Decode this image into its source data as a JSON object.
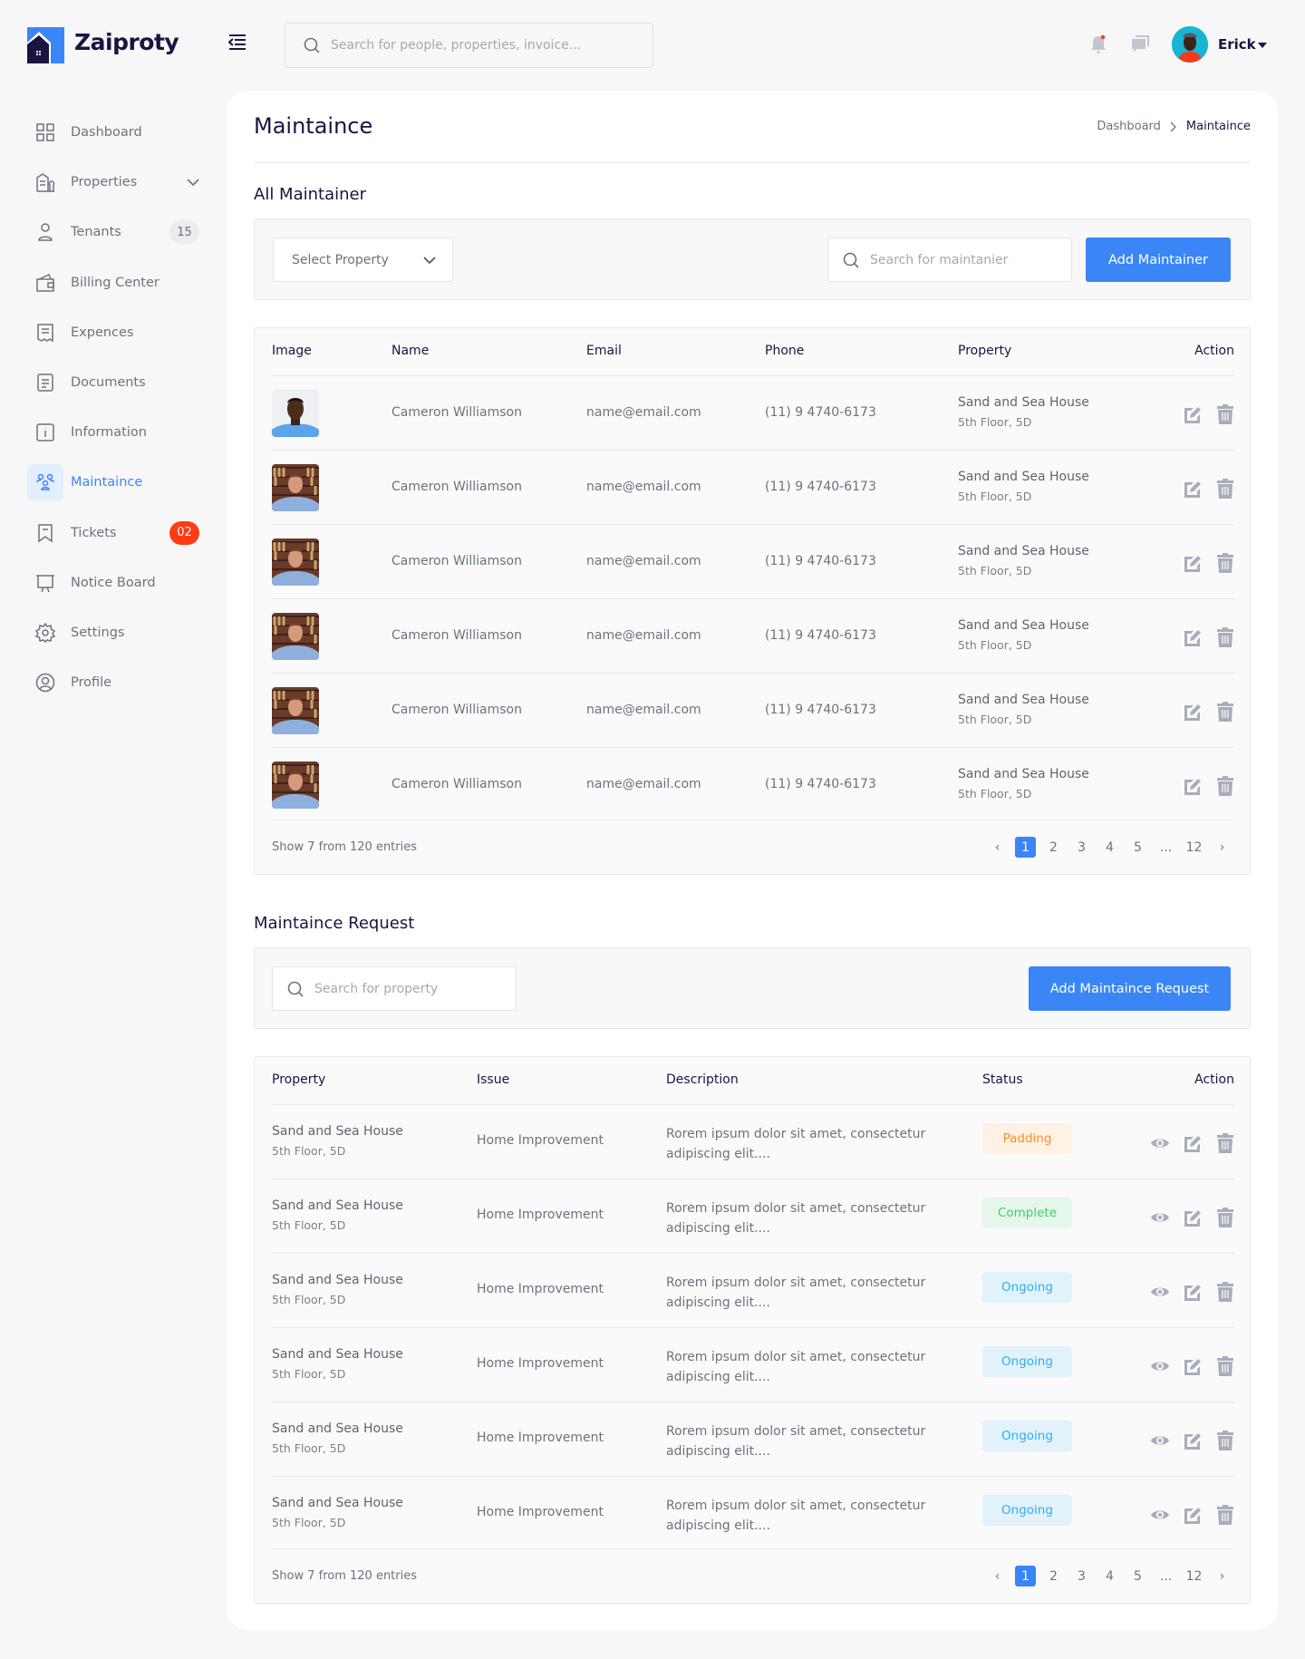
{
  "app": {
    "brand": "Zaiproty",
    "search_placeholder": "Search for people, properties, invoice...",
    "user": "Erick"
  },
  "sidebar": {
    "items": [
      {
        "label": "Dashboard",
        "icon": "dashboard-icon"
      },
      {
        "label": "Properties",
        "icon": "building-icon",
        "chevron": true
      },
      {
        "label": "Tenants",
        "icon": "user-icon",
        "badge": "15"
      },
      {
        "label": "Billing Center",
        "icon": "wallet-icon"
      },
      {
        "label": "Expences",
        "icon": "receipt-icon"
      },
      {
        "label": "Documents",
        "icon": "document-icon"
      },
      {
        "label": "Information",
        "icon": "info-icon"
      },
      {
        "label": "Maintaince",
        "icon": "team-icon",
        "active": true
      },
      {
        "label": "Tickets",
        "icon": "ticket-icon",
        "badge": "02",
        "badge_alert": true
      },
      {
        "label": "Notice Board",
        "icon": "board-icon"
      },
      {
        "label": "Settings",
        "icon": "gear-icon"
      },
      {
        "label": "Profile",
        "icon": "profile-icon"
      }
    ]
  },
  "page": {
    "title": "Maintaince",
    "breadcrumb": [
      "Dashboard",
      "Maintaince"
    ]
  },
  "maintainers": {
    "heading": "All Maintainer",
    "select_label": "Select Property",
    "search_placeholder": "Search for maintanier",
    "add_label": "Add Maintainer",
    "columns": [
      "Image",
      "Name",
      "Email",
      "Phone",
      "Property",
      "Action"
    ],
    "rows": [
      {
        "name": "Cameron Williamson",
        "email": "name@email.com",
        "phone": "(11) 9 4740-6173",
        "property": "Sand and Sea House",
        "unit": "5th Floor, 5D",
        "photo": "a"
      },
      {
        "name": "Cameron Williamson",
        "email": "name@email.com",
        "phone": "(11) 9 4740-6173",
        "property": "Sand and Sea House",
        "unit": "5th Floor, 5D",
        "photo": "b"
      },
      {
        "name": "Cameron Williamson",
        "email": "name@email.com",
        "phone": "(11) 9 4740-6173",
        "property": "Sand and Sea House",
        "unit": "5th Floor, 5D",
        "photo": "b"
      },
      {
        "name": "Cameron Williamson",
        "email": "name@email.com",
        "phone": "(11) 9 4740-6173",
        "property": "Sand and Sea House",
        "unit": "5th Floor, 5D",
        "photo": "b"
      },
      {
        "name": "Cameron Williamson",
        "email": "name@email.com",
        "phone": "(11) 9 4740-6173",
        "property": "Sand and Sea House",
        "unit": "5th Floor, 5D",
        "photo": "b"
      },
      {
        "name": "Cameron Williamson",
        "email": "name@email.com",
        "phone": "(11) 9 4740-6173",
        "property": "Sand and Sea House",
        "unit": "5th Floor, 5D",
        "photo": "b"
      }
    ],
    "footer": "Show 7 from 120 entries",
    "pages": [
      "1",
      "2",
      "3",
      "4",
      "5",
      "...",
      "12"
    ],
    "current_page": "1"
  },
  "requests": {
    "heading": "Maintaince Request",
    "search_placeholder": "Search for property",
    "add_label": "Add Maintaince Request",
    "columns": [
      "Property",
      "Issue",
      "Description",
      "Status",
      "Action"
    ],
    "rows": [
      {
        "property": "Sand and Sea House",
        "unit": "5th Floor, 5D",
        "issue": "Home Improvement",
        "desc1": "Rorem ipsum dolor sit amet, consectetur",
        "desc2": "adipiscing elit....",
        "status": "Padding",
        "status_color": "#fb8c2c",
        "status_bg": "#fff1e3"
      },
      {
        "property": "Sand and Sea House",
        "unit": "5th Floor, 5D",
        "issue": "Home Improvement",
        "desc1": "Rorem ipsum dolor sit amet, consectetur",
        "desc2": "adipiscing elit....",
        "status": "Complete",
        "status_color": "#3ecf6b",
        "status_bg": "#e5f6ea"
      },
      {
        "property": "Sand and Sea House",
        "unit": "5th Floor, 5D",
        "issue": "Home Improvement",
        "desc1": "Rorem ipsum dolor sit amet, consectetur",
        "desc2": "adipiscing elit....",
        "status": "Ongoing",
        "status_color": "#29aff2",
        "status_bg": "#e2f2fb"
      },
      {
        "property": "Sand and Sea House",
        "unit": "5th Floor, 5D",
        "issue": "Home Improvement",
        "desc1": "Rorem ipsum dolor sit amet, consectetur",
        "desc2": "adipiscing elit....",
        "status": "Ongoing",
        "status_color": "#29aff2",
        "status_bg": "#e2f2fb"
      },
      {
        "property": "Sand and Sea House",
        "unit": "5th Floor, 5D",
        "issue": "Home Improvement",
        "desc1": "Rorem ipsum dolor sit amet, consectetur",
        "desc2": "adipiscing elit....",
        "status": "Ongoing",
        "status_color": "#29aff2",
        "status_bg": "#e2f2fb"
      },
      {
        "property": "Sand and Sea House",
        "unit": "5th Floor, 5D",
        "issue": "Home Improvement",
        "desc1": "Rorem ipsum dolor sit amet, consectetur",
        "desc2": "adipiscing elit....",
        "status": "Ongoing",
        "status_color": "#29aff2",
        "status_bg": "#e2f2fb"
      }
    ],
    "footer": "Show 7 from 120 entries",
    "pages": [
      "1",
      "2",
      "3",
      "4",
      "5",
      "...",
      "12"
    ],
    "current_page": "1"
  },
  "colors": {
    "accent": "#3a86f7",
    "navy": "#1a1442",
    "alert": "#ff3b14"
  }
}
